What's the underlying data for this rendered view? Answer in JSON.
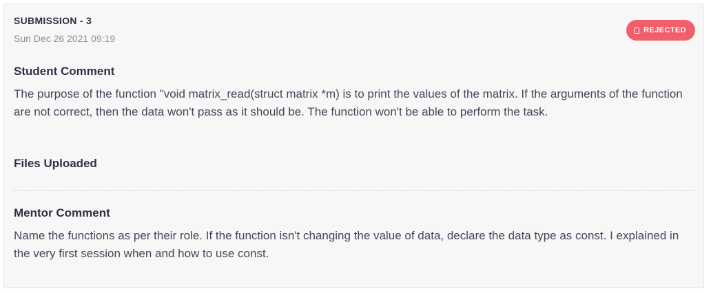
{
  "submission": {
    "title": "SUBMISSION - 3",
    "date": "Sun Dec 26 2021 09:19",
    "status": {
      "label": "REJECTED",
      "icon": "document-icon",
      "color": "#f25f6b"
    }
  },
  "student_comment": {
    "heading": "Student Comment",
    "text": "The purpose of the function \"void matrix_read(struct matrix *m) is to print the values of the matrix. If the arguments of the function are not correct, then the data won't pass as it should be. The function won't be able to perform the task."
  },
  "files": {
    "heading": "Files Uploaded"
  },
  "mentor_comment": {
    "heading": "Mentor Comment",
    "text": "Name the functions as per their role. If the function isn't changing the value of data, declare the data type as const. I explained in the very first session when and how to use const."
  }
}
